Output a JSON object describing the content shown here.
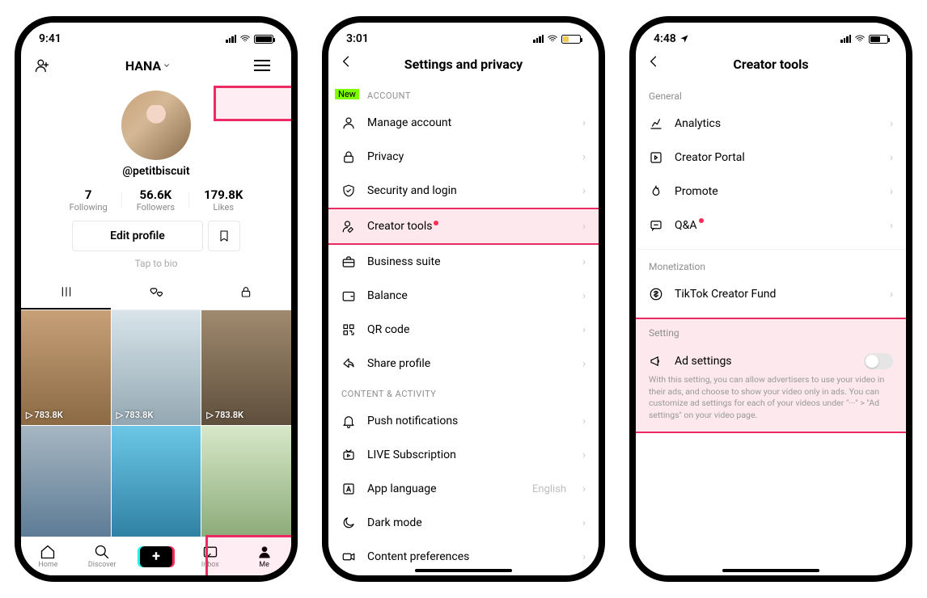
{
  "phone1": {
    "time": "9:41",
    "location_arrow": false,
    "battery": "full",
    "name": "HANA",
    "username": "@petitbiscuit",
    "stats": {
      "following_num": "7",
      "following_lbl": "Following",
      "followers_num": "56.6K",
      "followers_lbl": "Followers",
      "likes_num": "179.8K",
      "likes_lbl": "Likes"
    },
    "edit_label": "Edit profile",
    "bio_placeholder": "Tap to bio",
    "views": "783.8K",
    "nav": {
      "home": "Home",
      "discover": "Discover",
      "inbox": "Inbox",
      "me": "Me"
    }
  },
  "phone2": {
    "time": "3:01",
    "battery": "low",
    "title": "Settings and privacy",
    "section_account": "Account",
    "new_badge": "New",
    "rows": {
      "manage": "Manage account",
      "privacy": "Privacy",
      "security": "Security and login",
      "creator": "Creator tools",
      "business": "Business suite",
      "balance": "Balance",
      "qr": "QR code",
      "share": "Share profile"
    },
    "section_content": "Content & Activity",
    "rows2": {
      "push": "Push notifications",
      "live": "LIVE Subscription",
      "lang": "App language",
      "lang_val": "English",
      "dark": "Dark mode",
      "prefs": "Content preferences"
    }
  },
  "phone3": {
    "time": "4:48",
    "battery": "half",
    "title": "Creator tools",
    "section_general": "General",
    "rows": {
      "analytics": "Analytics",
      "portal": "Creator Portal",
      "promote": "Promote",
      "qa": "Q&A"
    },
    "section_monet": "Monetization",
    "fund": "TikTok Creator Fund",
    "section_setting": "Setting",
    "ad_title": "Ad settings",
    "ad_sub": "With this setting, you can allow advertisers to use your video in their ads, and choose to show your video only in ads. You can customize ad settings for each of your videos under  \"···\" > \"Ad settings\" on your video page."
  }
}
